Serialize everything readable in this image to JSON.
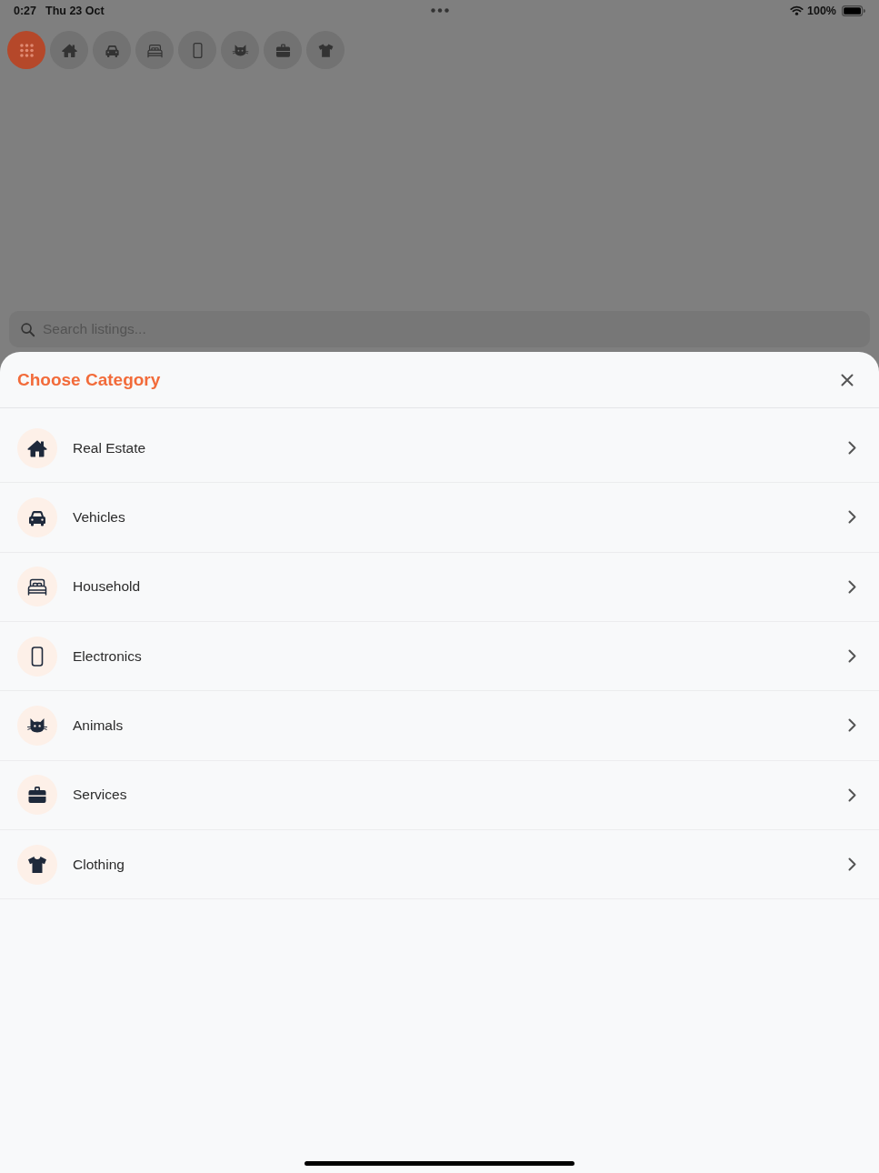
{
  "status_bar": {
    "time": "0:27",
    "date": "Thu 23 Oct",
    "battery": "100%"
  },
  "category_chips": [
    {
      "kind": "all",
      "selected": true
    },
    {
      "kind": "property",
      "selected": false
    },
    {
      "kind": "vehicles",
      "selected": false
    },
    {
      "kind": "household",
      "selected": false
    },
    {
      "kind": "electronics",
      "selected": false
    },
    {
      "kind": "animals",
      "selected": false
    },
    {
      "kind": "services",
      "selected": false
    },
    {
      "kind": "clothing",
      "selected": false
    }
  ],
  "search": {
    "placeholder": "Search listings..."
  },
  "sheet": {
    "title": "Choose Category",
    "categories": [
      {
        "kind": "property",
        "label": "Real Estate"
      },
      {
        "kind": "vehicles",
        "label": "Vehicles"
      },
      {
        "kind": "household",
        "label": "Household"
      },
      {
        "kind": "electronics",
        "label": "Electronics"
      },
      {
        "kind": "animals",
        "label": "Animals"
      },
      {
        "kind": "services",
        "label": "Services"
      },
      {
        "kind": "clothing",
        "label": "Clothing"
      }
    ]
  }
}
